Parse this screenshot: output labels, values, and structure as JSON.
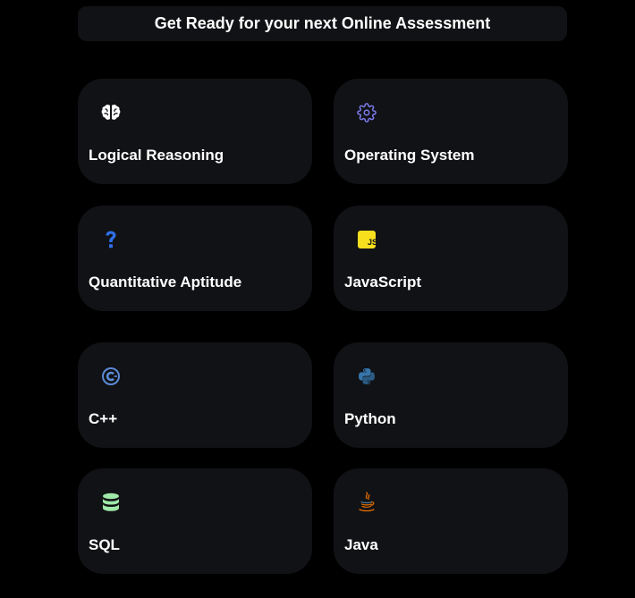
{
  "header": {
    "title": "Get Ready for your next Online Assessment"
  },
  "cards": [
    {
      "label": "Logical Reasoning",
      "icon": "brain-icon",
      "color": "#ffffff"
    },
    {
      "label": "Operating System",
      "icon": "gear-icon",
      "color": "#7c7cf0"
    },
    {
      "label": "Quantitative Aptitude",
      "icon": "question-mark-icon",
      "color": "#2f6fe8"
    },
    {
      "label": "JavaScript",
      "icon": "javascript-icon",
      "color": "#f7df1e"
    },
    {
      "label": "C++",
      "icon": "cplusplus-icon",
      "color": "#5b8bd6"
    },
    {
      "label": "Python",
      "icon": "python-icon",
      "color": "#3776ab"
    },
    {
      "label": "SQL",
      "icon": "database-icon",
      "color": "#9ee8a8"
    },
    {
      "label": "Java",
      "icon": "java-icon",
      "color": "#e76f00"
    }
  ]
}
